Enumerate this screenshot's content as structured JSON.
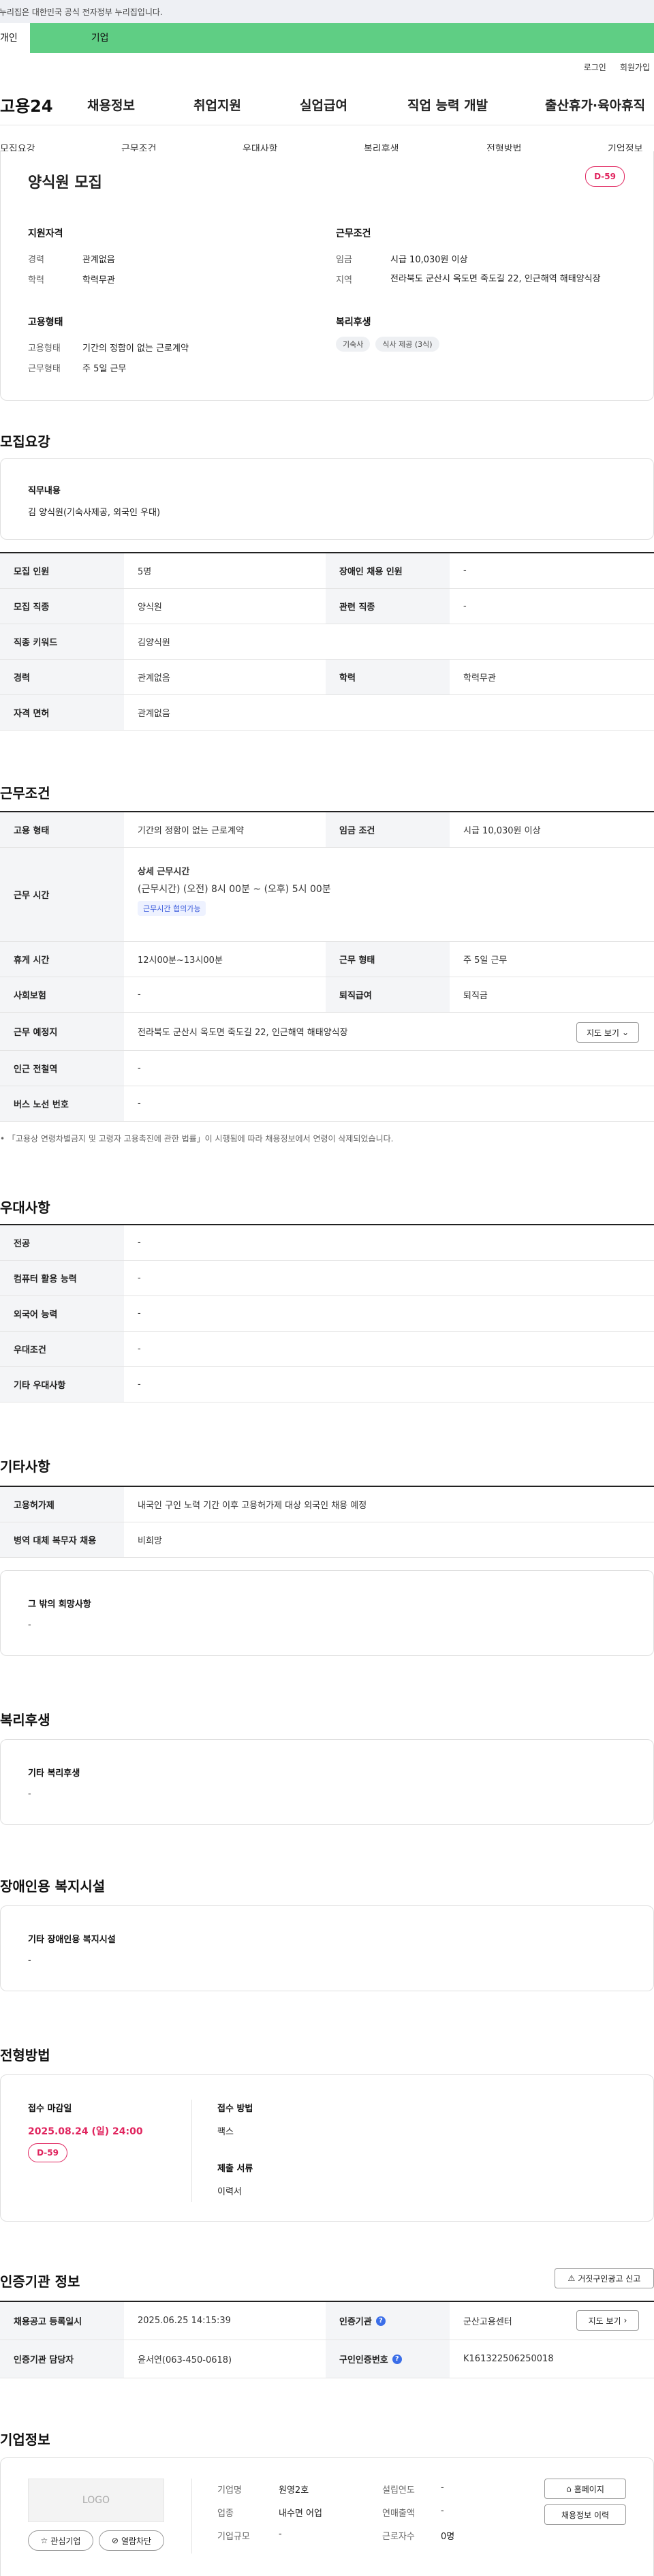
{
  "gov_banner": "이 누리집은 대한민국 공식 전자정부 누리집입니다.",
  "top_tabs": {
    "personal": "개인",
    "company": "기업"
  },
  "util": {
    "login": "로그인",
    "join": "회원가입"
  },
  "brand": "고용24",
  "gnb": [
    "채용정보",
    "취업지원",
    "실업급여",
    "직업 능력 개발",
    "출산휴가·육아휴직"
  ],
  "anchors": [
    "모집요강",
    "근무조건",
    "우대사항",
    "복리후생",
    "전형방법",
    "기업정보"
  ],
  "summary": {
    "title": "양식원 모집",
    "dday": "D-59",
    "qual_title": "지원자격",
    "career_label": "경력",
    "career": "관계없음",
    "edu_label": "학력",
    "edu": "학력무관",
    "cond_title": "근무조건",
    "wage_label": "임금",
    "wage": "시급 10,030원 이상",
    "area_label": "지역",
    "area": "전라북도 군산시 옥도면 죽도길 22, 인근해역 해태양식장",
    "emp_title": "고용형태",
    "etype_label": "고용형태",
    "etype": "기간의 정함이 없는 근로계약",
    "eform_label": "근무형태",
    "eform": "주 5일 근무",
    "welfare_title": "복리후생",
    "welfare_tags": [
      "기숙사",
      "식사 제공 (3식)"
    ]
  },
  "recruit": {
    "heading": "모집요강",
    "job_label": "직무내용",
    "job": "김 양식원(기숙사제공, 외국인 우대)",
    "rows": [
      [
        "모집 인원",
        "5명",
        "장애인 채용 인원",
        "-"
      ],
      [
        "모집 직종",
        "양식원",
        "관련 직종",
        "-"
      ],
      [
        "직종 키워드",
        "김양식원"
      ],
      [
        "경력",
        "관계없음",
        "학력",
        "학력무관"
      ],
      [
        "자격 면허",
        "관계없음"
      ]
    ]
  },
  "work": {
    "heading": "근무조건",
    "etype_l": "고용 형태",
    "etype": "기간의 정함이 없는 근로계약",
    "wage_l": "임금 조건",
    "wage": "시급 10,030원 이상",
    "hours_l": "근무 시간",
    "hours_title": "상세 근무시간",
    "hours": "(근무시간) (오전) 8시 00분 ~ (오후) 5시 00분",
    "hours_tag": "근무시간 협의가능",
    "rest_l": "휴게 시간",
    "rest": "12시00분~13시00분",
    "form_l": "근무 형태",
    "form": "주 5일 근무",
    "ins_l": "사회보험",
    "ins": "-",
    "sev_l": "퇴직급여",
    "sev": "퇴직금",
    "place_l": "근무 예정지",
    "place": "전라북도 군산시 옥도면 죽도길 22, 인근해역 해태양식장",
    "map_btn": "지도 보기",
    "subway_l": "인근 전철역",
    "subway": "-",
    "bus_l": "버스 노선 번호",
    "bus": "-",
    "note": "「고용상 연령차별금지 및 고령자 고용촉진에 관한 법률」이 시행됨에 따라 채용정보에서 연령이 삭제되었습니다."
  },
  "pref": {
    "heading": "우대사항",
    "rows": [
      [
        "전공",
        "-"
      ],
      [
        "컴퓨터 활용 능력",
        "-"
      ],
      [
        "외국어 능력",
        "-"
      ],
      [
        "우대조건",
        "-"
      ],
      [
        "기타 우대사항",
        "-"
      ]
    ]
  },
  "etc": {
    "heading": "기타사항",
    "rows": [
      [
        "고용허가제",
        "내국인 구인 노력 기간 이후 고용허가제 대상 외국인 채용 예정"
      ],
      [
        "병역 대체 복무자 채용",
        "비희망"
      ]
    ],
    "box_title": "그 밖의 희망사항",
    "box_val": "-"
  },
  "welfare": {
    "heading": "복리후생",
    "box_title": "기타 복리후생",
    "box_val": "-"
  },
  "disab": {
    "heading": "장애인용 복지시설",
    "box_title": "기타 장애인용 복지시설",
    "box_val": "-"
  },
  "process": {
    "heading": "전형방법",
    "deadline_l": "접수 마감일",
    "deadline": "2025.08.24 (일) 24:00",
    "dday": "D-59",
    "method_l": "접수 방법",
    "method": "팩스",
    "docs_l": "제출 서류",
    "docs": "이력서"
  },
  "cert": {
    "heading": "인증기관 정보",
    "report_btn": "거짓구인광고 신고",
    "reg_l": "채용공고 등록일시",
    "reg": "2025.06.25 14:15:39",
    "org_l": "인증기관",
    "org": "군산고용센터",
    "map_btn": "지도 보기",
    "mgr_l": "인증기관 담당자",
    "mgr": "윤서연(063-450-0618)",
    "num_l": "구인인증번호",
    "num": "K161322506250018"
  },
  "company": {
    "heading": "기업정보",
    "logo": "LOGO",
    "fav_btn": "관심기업",
    "block_btn": "열람차단",
    "name_l": "기업명",
    "name": "원영2호",
    "type_l": "업종",
    "type": "내수면 어업",
    "size_l": "기업규모",
    "size": "-",
    "year_l": "설립연도",
    "year": "-",
    "sales_l": "연매출액",
    "sales": "-",
    "emp_l": "근로자수",
    "emp": "0명",
    "home_btn": "홈페이지",
    "info_btn": "채용정보 이력"
  }
}
